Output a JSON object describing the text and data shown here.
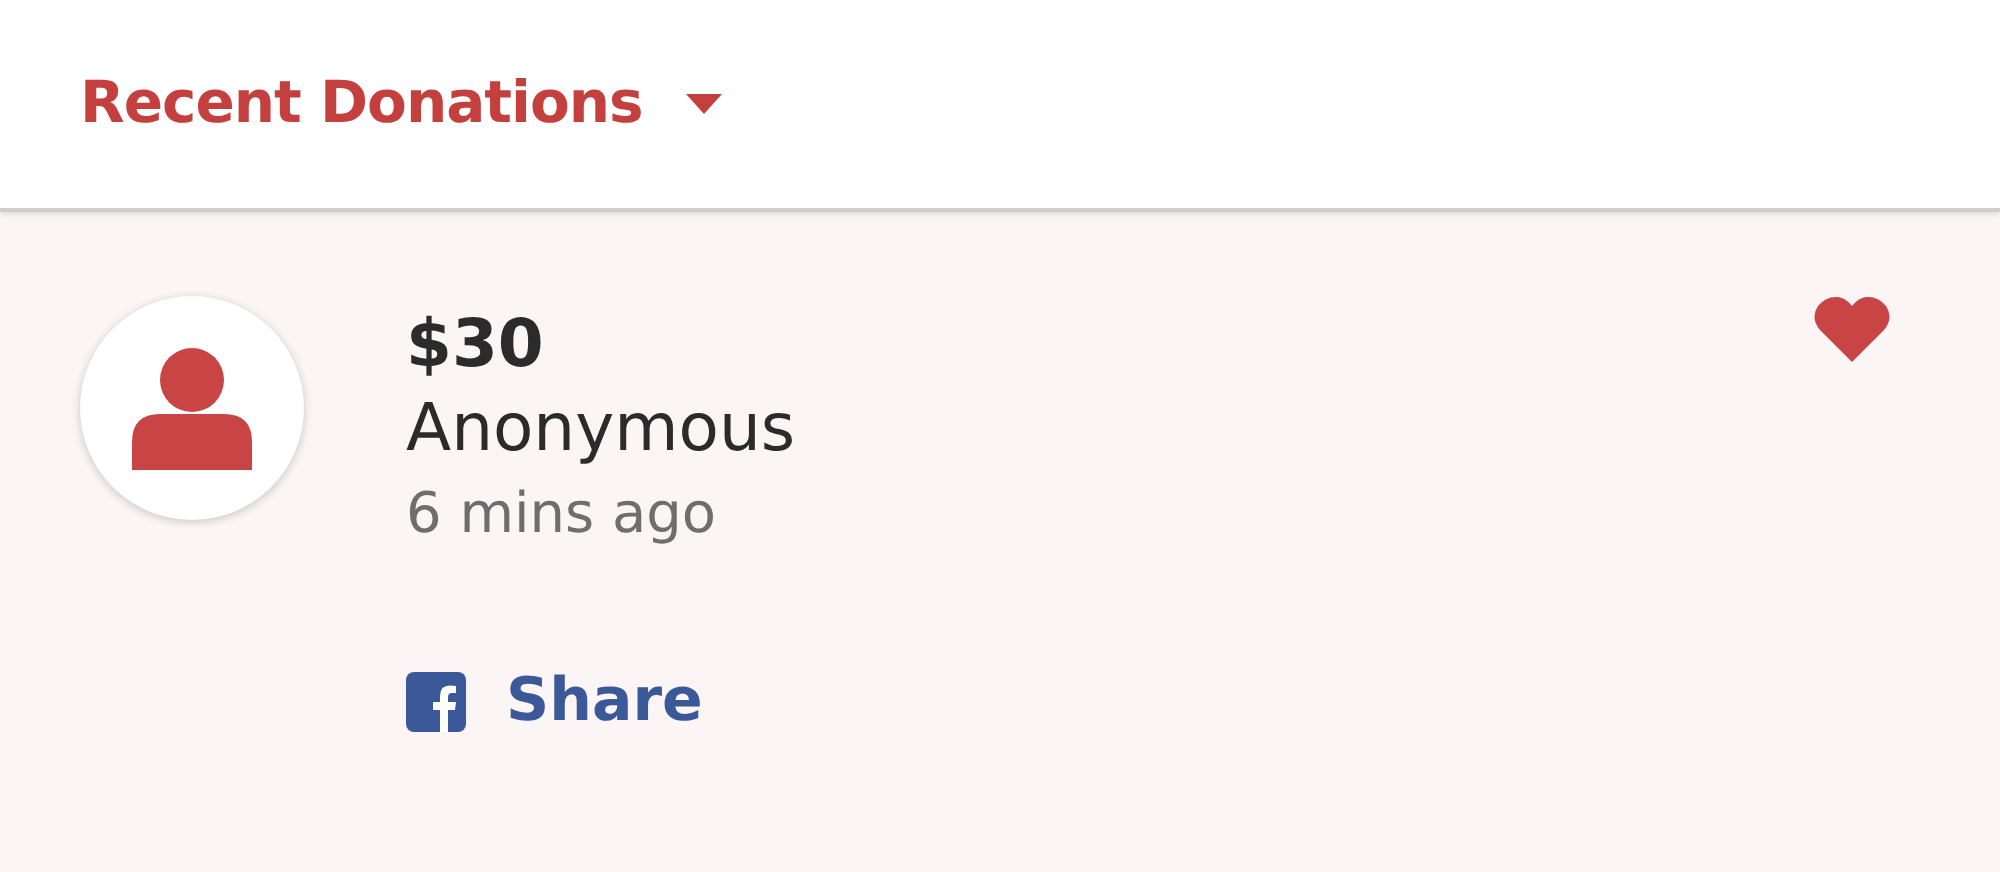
{
  "header": {
    "title": "Recent Donations"
  },
  "donations": [
    {
      "amount": "$30",
      "name": "Anonymous",
      "time": "6 mins ago",
      "share_label": "Share"
    }
  ]
}
